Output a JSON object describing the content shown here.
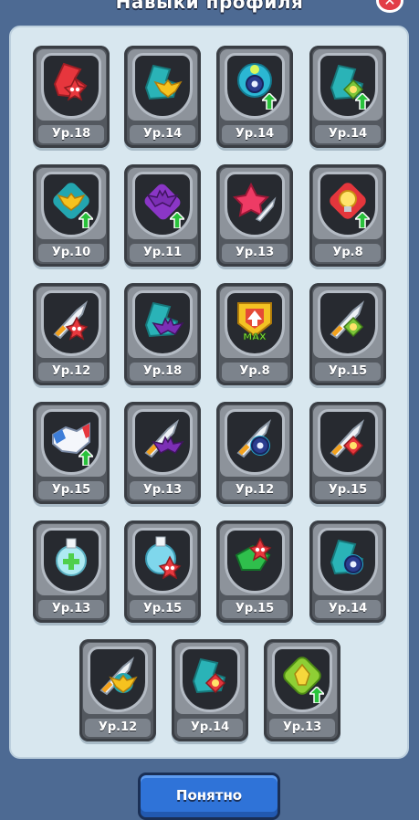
{
  "header": {
    "title": "Навыки профиля"
  },
  "close_icon": "close-icon",
  "colors": {
    "background": "#4d6a93",
    "panel": "#d8e7ef",
    "button": "#2f73d8",
    "upgrade": "#29c23b"
  },
  "skills": [
    {
      "level": "Ур.18",
      "icon": "red-star-hat-icon",
      "upgrade": false
    },
    {
      "level": "Ур.14",
      "icon": "teal-hat-eagle-icon",
      "upgrade": false
    },
    {
      "level": "Ур.14",
      "icon": "blue-eye-bomb-icon",
      "upgrade": true
    },
    {
      "level": "Ур.14",
      "icon": "teal-hat-green-gem-icon",
      "upgrade": true
    },
    {
      "level": "Ур.10",
      "icon": "golden-eagle-teal-icon",
      "upgrade": true
    },
    {
      "level": "Ур.11",
      "icon": "purple-bat-icon",
      "upgrade": true
    },
    {
      "level": "Ур.13",
      "icon": "pink-star-sword-icon",
      "upgrade": false
    },
    {
      "level": "Ур.8",
      "icon": "lightbulb-red-gem-icon",
      "upgrade": true
    },
    {
      "level": "Ур.12",
      "icon": "sword-red-star-icon",
      "upgrade": false
    },
    {
      "level": "Ур.18",
      "icon": "teal-hat-purple-bat-icon",
      "upgrade": false
    },
    {
      "level": "Ур.8",
      "icon": "max-arrow-shield-icon",
      "upgrade": false,
      "badge": "MAX"
    },
    {
      "level": "Ур.15",
      "icon": "sword-green-gem-icon",
      "upgrade": false
    },
    {
      "level": "Ур.15",
      "icon": "handshake-icon",
      "upgrade": true
    },
    {
      "level": "Ур.13",
      "icon": "sword-purple-bat-icon",
      "upgrade": false
    },
    {
      "level": "Ур.12",
      "icon": "sword-blue-bomb-icon",
      "upgrade": false
    },
    {
      "level": "Ур.15",
      "icon": "sword-red-gem-icon",
      "upgrade": false
    },
    {
      "level": "Ур.13",
      "icon": "healing-potion-icon",
      "upgrade": false
    },
    {
      "level": "Ур.15",
      "icon": "potion-red-star-icon",
      "upgrade": false
    },
    {
      "level": "Ур.15",
      "icon": "green-mask-red-star-icon",
      "upgrade": false
    },
    {
      "level": "Ур.14",
      "icon": "teal-hat-blue-bomb-icon",
      "upgrade": false
    },
    {
      "level": "Ур.12",
      "icon": "sword-golden-eagle-icon",
      "upgrade": false
    },
    {
      "level": "Ур.14",
      "icon": "teal-hat-red-gem-icon",
      "upgrade": false
    },
    {
      "level": "Ур.13",
      "icon": "green-gem-diamond-icon",
      "upgrade": true
    }
  ],
  "button": {
    "label": "Понятно"
  }
}
